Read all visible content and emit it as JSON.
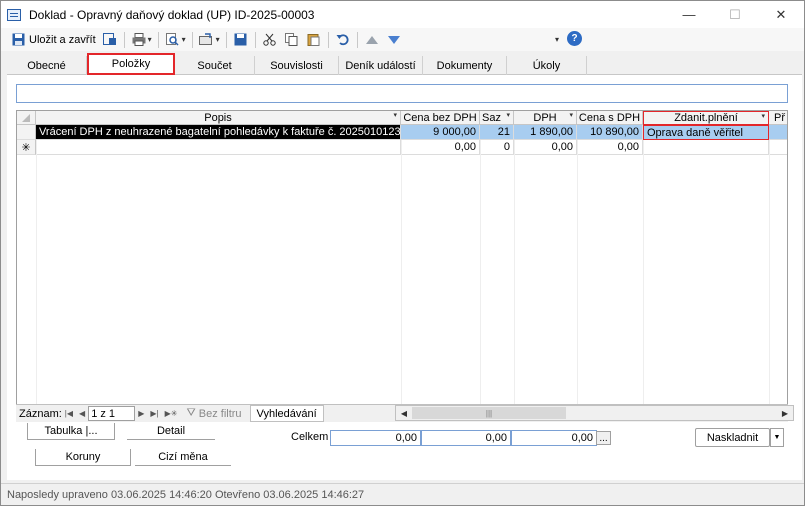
{
  "window": {
    "title": "Doklad - Opravný daňový doklad (UP) ID-2025-00003",
    "minimize": "—",
    "maximize": "☐",
    "close": "✕"
  },
  "toolbar": {
    "save_close_label": "Uložit a zavřít"
  },
  "tabs": [
    "Obecné",
    "Položky",
    "Součet",
    "Souvislosti",
    "Deník událostí",
    "Dokumenty",
    "Úkoly"
  ],
  "grid": {
    "columns": [
      "Popis",
      "Cena bez DPH",
      "Saz",
      "DPH",
      "Cena s DPH",
      "Zdanit.plnění",
      "Př"
    ],
    "rows": [
      {
        "popis": "Vrácení DPH z neuhrazené bagatelní pohledávky k faktuře č. 2025010123",
        "cena_bez": "9 000,00",
        "saz": "21",
        "dph": "1 890,00",
        "cena_s": "10 890,00",
        "zdanit": "Oprava daně věřitel"
      },
      {
        "indicator": "✳",
        "popis": "",
        "cena_bez": "0,00",
        "saz": "0",
        "dph": "0,00",
        "cena_s": "0,00",
        "zdanit": ""
      }
    ]
  },
  "navigator": {
    "label": "Záznam:",
    "position": "1 z 1",
    "no_filter": "Bez filtru",
    "search": "Vyhledávání"
  },
  "bottom_tabs": {
    "tabulka": "Tabulka",
    "ellipsis": "|...",
    "detail": "Detail",
    "koruny": "Koruny",
    "cizi_mena": "Cizí měna"
  },
  "totals": {
    "label": "Celkem",
    "values": [
      "0,00",
      "0,00",
      "0,00"
    ],
    "ellipsis": "..."
  },
  "naskladnit": "Naskladnit",
  "status": "Naposledy upraveno 03.06.2025 14:46:20 Otevřeno 03.06.2025 14:46:27",
  "colors": {
    "selection": "#a8cdf0",
    "highlight_border": "#e3262a",
    "accent": "#2d6bc4"
  }
}
